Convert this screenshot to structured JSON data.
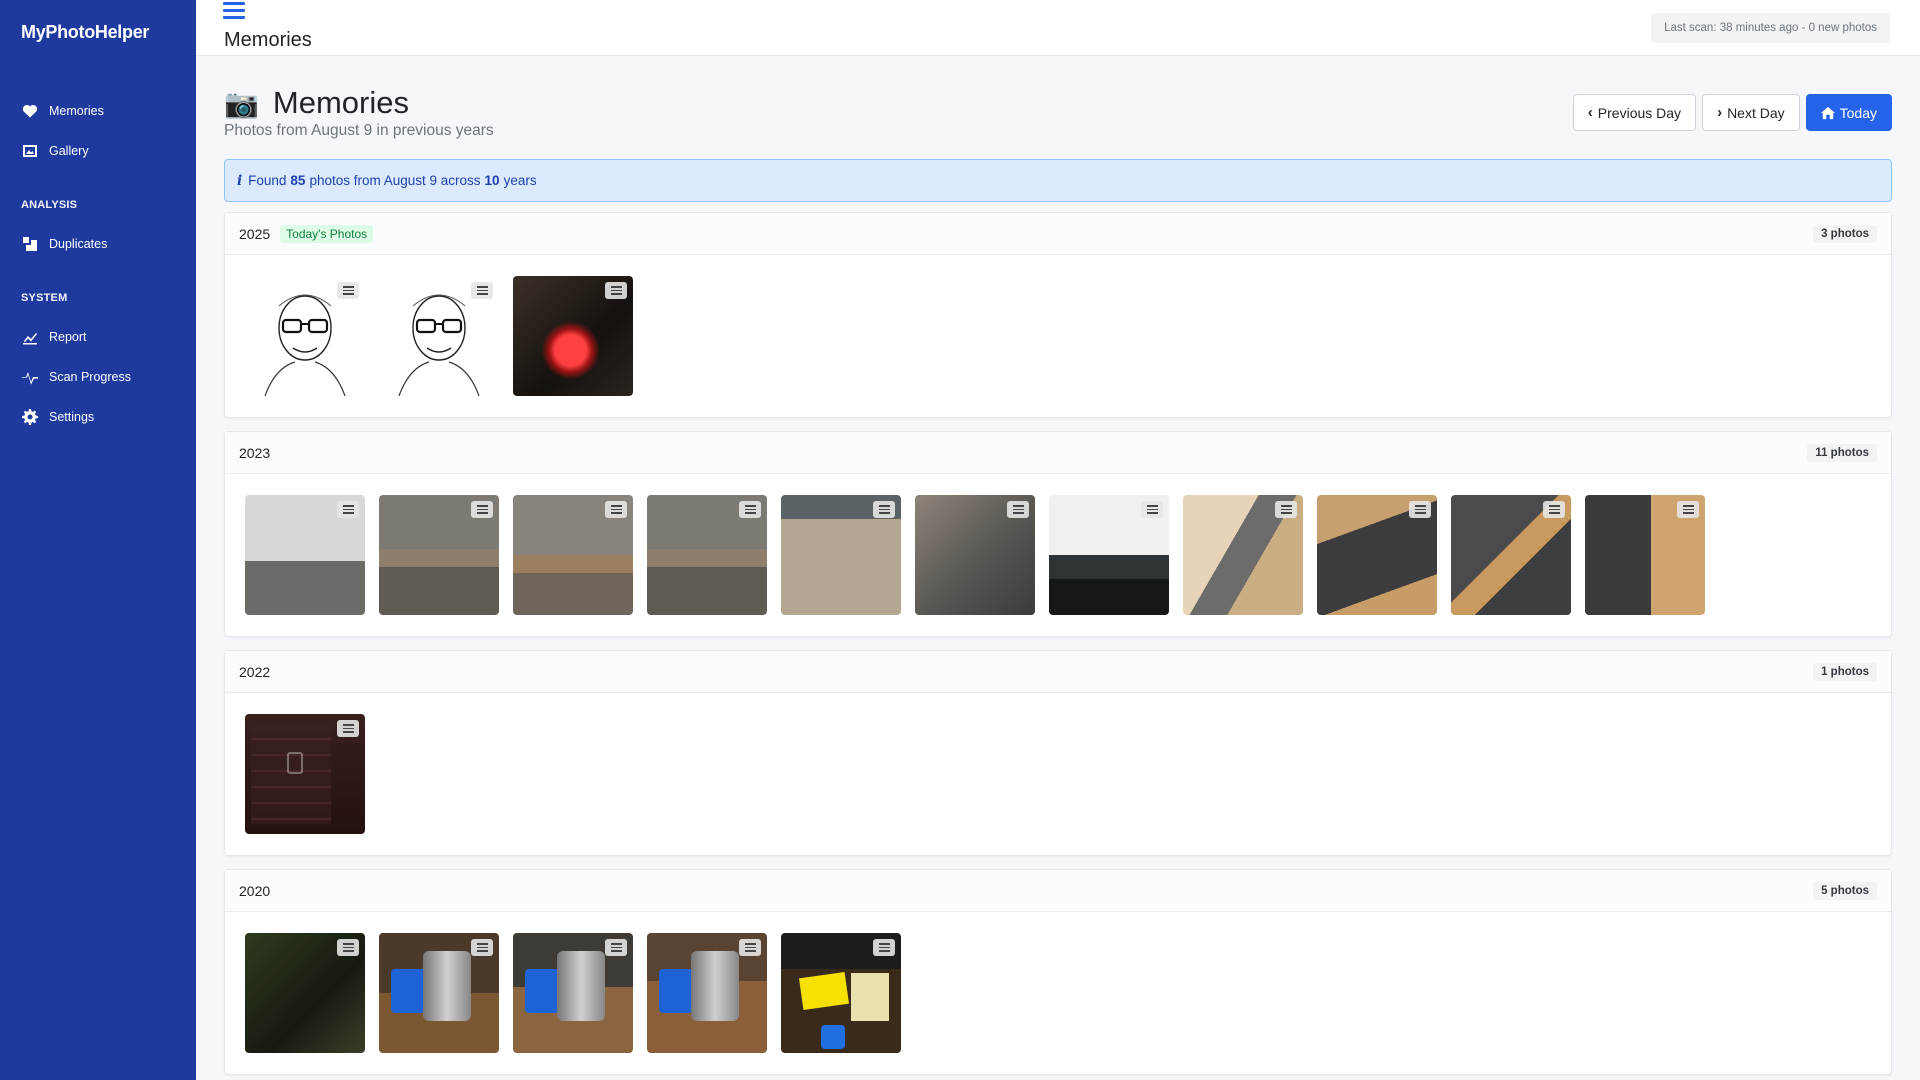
{
  "app": {
    "brand": "MyPhotoHelper"
  },
  "sidebar": {
    "items_top": [
      {
        "label": "Memories",
        "icon": "heart-icon"
      },
      {
        "label": "Gallery",
        "icon": "image-icon"
      }
    ],
    "analysis_label": "ANALYSIS",
    "analysis_items": [
      {
        "label": "Duplicates",
        "icon": "duplicates-icon"
      }
    ],
    "system_label": "SYSTEM",
    "system_items": [
      {
        "label": "Report",
        "icon": "chart-line-icon"
      },
      {
        "label": "Scan Progress",
        "icon": "pulse-icon"
      },
      {
        "label": "Settings",
        "icon": "gear-icon"
      }
    ]
  },
  "topbar": {
    "title": "Memories",
    "scan_status": "Last scan: 38 minutes ago - 0 new photos"
  },
  "page": {
    "title": "Memories",
    "subtitle": "Photos from August 9 in previous years",
    "buttons": {
      "previous": "Previous Day",
      "next": "Next Day",
      "today": "Today"
    },
    "alert": {
      "found": "Found",
      "count": "85",
      "mid": "photos from August 9 across",
      "years": "10",
      "end": "years"
    }
  },
  "years": [
    {
      "year": "2025",
      "badge": "Today's Photos",
      "count_label": "3 photos",
      "thumbs": [
        "sketch",
        "sketch",
        "dark-red"
      ]
    },
    {
      "year": "2023",
      "badge": "",
      "count_label": "11 photos",
      "thumbs": [
        "room",
        "deck1",
        "deck2",
        "deck1",
        "grey1",
        "grey2",
        "desk",
        "wood1",
        "wood2",
        "wood3",
        "wood4"
      ]
    },
    {
      "year": "2022",
      "badge": "",
      "count_label": "1 photos",
      "thumbs": [
        "phone"
      ]
    },
    {
      "year": "2020",
      "badge": "",
      "count_label": "5 photos",
      "thumbs": [
        "pump1",
        "pump2",
        "pump3",
        "pump4",
        "pump5"
      ]
    }
  ],
  "colors": {
    "sidebar": "#1e3a9e",
    "accent": "#2563eb",
    "today_badge": "#15803d"
  }
}
